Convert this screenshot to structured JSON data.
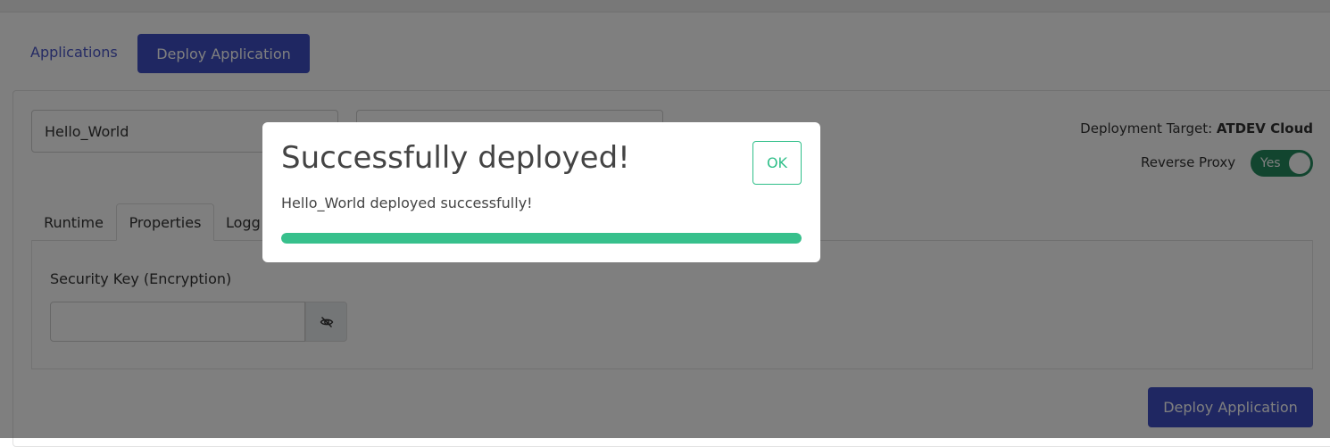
{
  "nav": {
    "applications_link": "Applications",
    "deploy_button": "Deploy Application"
  },
  "form": {
    "app_name_value": "Hello_World",
    "second_field_value": ""
  },
  "deployment": {
    "target_label": "Deployment Target: ",
    "target_value": "ATDEV Cloud",
    "reverse_proxy_label": "Reverse Proxy",
    "reverse_proxy_toggle": "Yes"
  },
  "tabs": [
    {
      "label": "Runtime"
    },
    {
      "label": "Properties"
    },
    {
      "label": "Logg"
    }
  ],
  "properties": {
    "security_key_label": "Security Key (Encryption)",
    "security_key_value": "",
    "visibility_icon": "eye-slash-icon"
  },
  "footer": {
    "deploy_button": "Deploy Application"
  },
  "modal": {
    "title": "Successfully deployed!",
    "ok_label": "OK",
    "message": "Hello_World deployed successfully!",
    "progress_fraction": 1.0,
    "progress_color": "#37c08c"
  },
  "colors": {
    "primary": "#3f4fc4",
    "toggle_on": "#248a5f",
    "success": "#2fbf89"
  }
}
